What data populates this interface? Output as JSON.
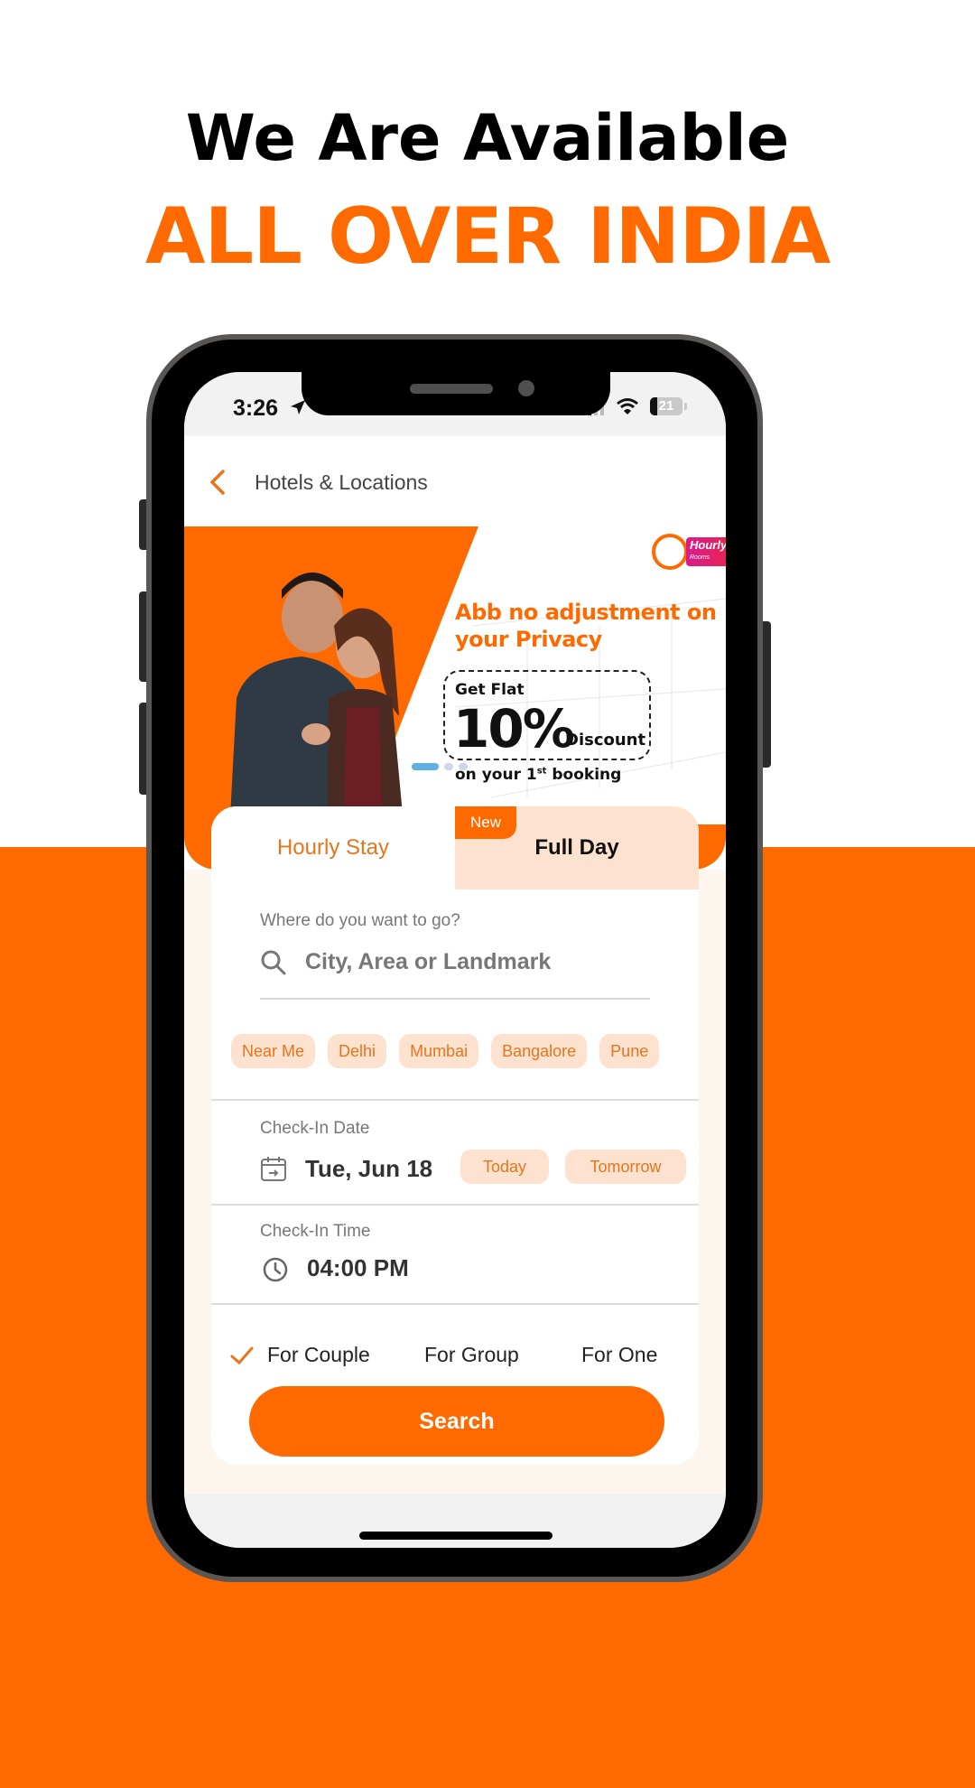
{
  "promo": {
    "headline_line1": "We Are Available",
    "headline_line2": "ALL OVER INDIA",
    "brand_color": "#ff6a00"
  },
  "status_bar": {
    "time": "3:26",
    "battery_level": "21",
    "battery_fraction": 0.21,
    "icons": [
      "location-arrow-icon",
      "signal-icon",
      "wifi-icon",
      "battery-icon"
    ]
  },
  "header": {
    "back_icon": "chevron-left-icon",
    "title": "Hotels & Locations"
  },
  "banner": {
    "badge_title": "Hourly",
    "badge_subtitle": "Rooms",
    "heading": "Abb no adjustment on your Privacy",
    "coupon_prefix": "Get Flat",
    "coupon_value": "10%",
    "coupon_suffix": "Discount",
    "coupon_sub_before": "on your 1",
    "coupon_sub_sup": "st",
    "coupon_sub_after": " booking",
    "carousel_total": 3,
    "carousel_active": 1
  },
  "tabs": [
    {
      "label": "Hourly Stay",
      "active": true
    },
    {
      "label": "Full Day",
      "active": false,
      "badge": "New"
    }
  ],
  "search": {
    "label": "Where do you want to go?",
    "placeholder": "City, Area or Landmark",
    "value": ""
  },
  "city_chips": [
    "Near Me",
    "Delhi",
    "Mumbai",
    "Bangalore",
    "Pune"
  ],
  "checkin_date": {
    "label": "Check-In Date",
    "value": "Tue, Jun 18",
    "quick_options": [
      "Today",
      "Tomorrow"
    ]
  },
  "checkin_time": {
    "label": "Check-In Time",
    "value": "04:00 PM"
  },
  "guest_options": [
    {
      "label": "For Couple",
      "selected": true
    },
    {
      "label": "For Group",
      "selected": false
    },
    {
      "label": "For One",
      "selected": false
    }
  ],
  "search_button": {
    "label": "Search"
  }
}
